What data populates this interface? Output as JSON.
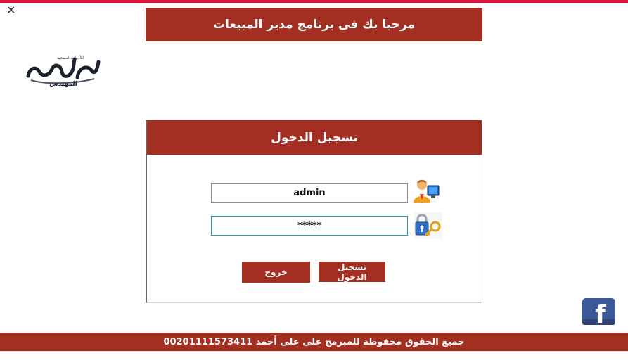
{
  "window": {
    "close_symbol": "×"
  },
  "header": {
    "welcome_text": "مرحبا بك فى برنامج مدير المبيعات"
  },
  "logo": {
    "text": "المهندس",
    "subtext": "للأدوات الصحية"
  },
  "login": {
    "title": "تسجيل الدخول",
    "username_value": "admin",
    "password_value": "*****",
    "login_button": "تسجيل الدخول",
    "exit_button": "خروج",
    "user_icon": "user-computer-icon",
    "key_icon": "lock-key-icon"
  },
  "social": {
    "facebook_icon": "facebook-icon",
    "facebook_letter": "f"
  },
  "footer": {
    "copyright": "جميع الحقوق محفوظة للمبرمج على على أحمد 00201111573411"
  },
  "colors": {
    "accent": "#a32e22",
    "top_strip": "#dc143c",
    "facebook": "#3b5998"
  }
}
